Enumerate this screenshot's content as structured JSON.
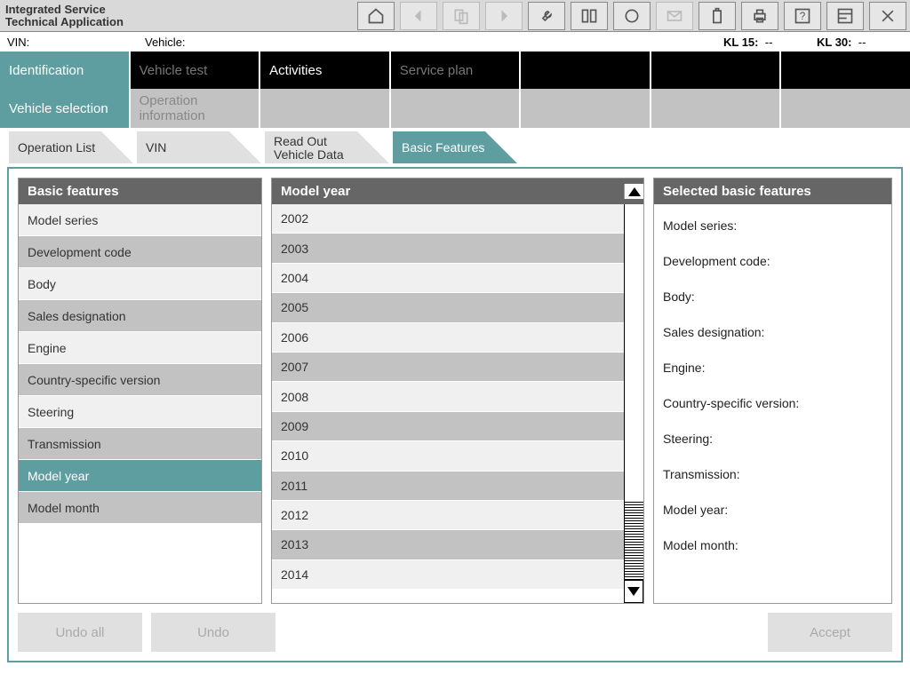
{
  "app": {
    "title": "Integrated Service Technical Application"
  },
  "info": {
    "vin_label": "VIN:",
    "vehicle_label": "Vehicle:",
    "kl15_label": "KL 15:",
    "kl15_value": "--",
    "kl30_label": "KL 30:",
    "kl30_value": "--"
  },
  "mainnav": {
    "tabs": [
      {
        "label": "Identification",
        "active": true
      },
      {
        "label": "Vehicle test",
        "dim": true
      },
      {
        "label": "Activities"
      },
      {
        "label": "Service plan",
        "dim": true
      },
      {
        "label": ""
      },
      {
        "label": ""
      },
      {
        "label": ""
      }
    ]
  },
  "subnav": {
    "tabs": [
      {
        "label": "Vehicle selection",
        "active": true
      },
      {
        "label": "Operation information"
      },
      {
        "label": ""
      },
      {
        "label": ""
      },
      {
        "label": ""
      },
      {
        "label": ""
      },
      {
        "label": ""
      }
    ]
  },
  "crumbs": [
    {
      "label": "Operation List"
    },
    {
      "label": "VIN"
    },
    {
      "label": "Read Out Vehicle Data"
    },
    {
      "label": "Basic Features",
      "active": true
    }
  ],
  "left_panel": {
    "header": "Basic features",
    "items": [
      {
        "label": "Model series"
      },
      {
        "label": "Development code"
      },
      {
        "label": "Body"
      },
      {
        "label": "Sales designation"
      },
      {
        "label": "Engine"
      },
      {
        "label": "Country-specific version"
      },
      {
        "label": "Steering"
      },
      {
        "label": "Transmission"
      },
      {
        "label": "Model year",
        "selected": true
      },
      {
        "label": "Model month"
      }
    ]
  },
  "mid_panel": {
    "header": "Model year",
    "items": [
      {
        "label": "2002"
      },
      {
        "label": "2003"
      },
      {
        "label": "2004"
      },
      {
        "label": "2005"
      },
      {
        "label": "2006"
      },
      {
        "label": "2007"
      },
      {
        "label": "2008"
      },
      {
        "label": "2009"
      },
      {
        "label": "2010"
      },
      {
        "label": "2011"
      },
      {
        "label": "2012"
      },
      {
        "label": "2013"
      },
      {
        "label": "2014"
      }
    ]
  },
  "right_panel": {
    "header": "Selected basic features",
    "rows": [
      {
        "label": "Model series:"
      },
      {
        "label": "Development code:"
      },
      {
        "label": "Body:"
      },
      {
        "label": "Sales designation:"
      },
      {
        "label": "Engine:"
      },
      {
        "label": "Country-specific version:"
      },
      {
        "label": "Steering:"
      },
      {
        "label": "Transmission:"
      },
      {
        "label": "Model year:"
      },
      {
        "label": "Model month:"
      }
    ]
  },
  "footer": {
    "undo_all": "Undo all",
    "undo": "Undo",
    "accept": "Accept"
  },
  "icons": {
    "home": "home-icon",
    "back": "back-icon",
    "copy": "copy-icon",
    "forward": "forward-icon",
    "wrench": "wrench-icon",
    "compare": "compare-icon",
    "pill": "pill-icon",
    "mail": "mail-icon",
    "battery": "battery-icon",
    "print": "print-icon",
    "help": "help-icon",
    "layout": "layout-icon",
    "close": "close-icon"
  }
}
